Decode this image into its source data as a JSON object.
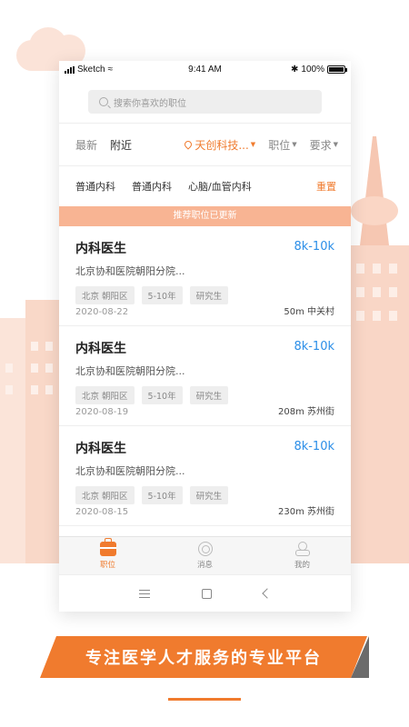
{
  "status_bar": {
    "carrier": "Sketch",
    "time": "9:41 AM",
    "battery": "100%"
  },
  "search": {
    "placeholder": "搜索你喜欢的职位"
  },
  "filters": {
    "latest": "最新",
    "nearby": "附近",
    "location": "天创科技...",
    "position": "职位",
    "requirement": "要求"
  },
  "tags": {
    "items": [
      "普通内科",
      "普通内科",
      "心脑/血管内科"
    ],
    "reset": "重置"
  },
  "notice": "推荐职位已更新",
  "jobs": [
    {
      "title": "内科医生",
      "salary": "8k-10k",
      "hospital": "北京协和医院朝阳分院...",
      "tags": [
        "北京 朝阳区",
        "5-10年",
        "研究生"
      ],
      "date": "2020-08-22",
      "distance": "50m 中关村"
    },
    {
      "title": "内科医生",
      "salary": "8k-10k",
      "hospital": "北京协和医院朝阳分院...",
      "tags": [
        "北京 朝阳区",
        "5-10年",
        "研究生"
      ],
      "date": "2020-08-19",
      "distance": "208m 苏州街"
    },
    {
      "title": "内科医生",
      "salary": "8k-10k",
      "hospital": "北京协和医院朝阳分院...",
      "tags": [
        "北京 朝阳区",
        "5-10年",
        "研究生"
      ],
      "date": "2020-08-15",
      "distance": "230m 苏州街"
    }
  ],
  "tabbar": {
    "jobs": "职位",
    "messages": "消息",
    "mine": "我的"
  },
  "banner": "专注医学人才服务的专业平台",
  "colors": {
    "accent": "#f07b2e",
    "salary": "#2b8ee8",
    "notice_bg": "#f8b493"
  }
}
